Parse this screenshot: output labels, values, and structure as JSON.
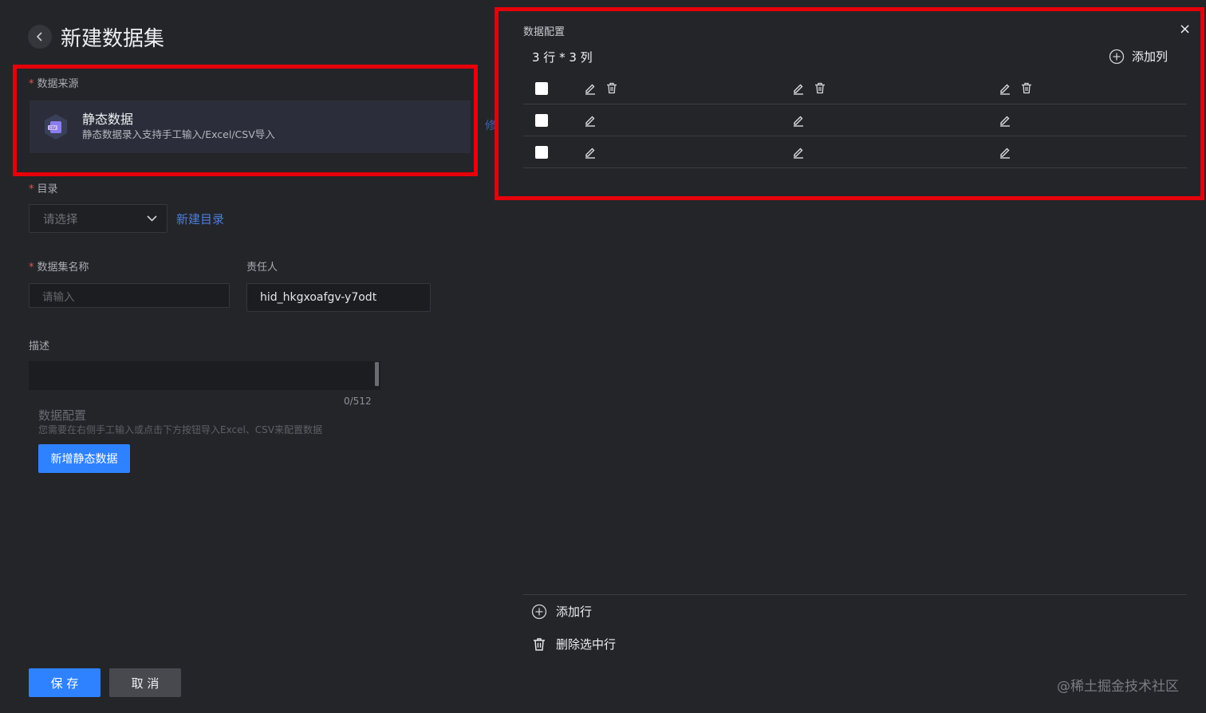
{
  "page": {
    "title": "新建数据集"
  },
  "data_source": {
    "label": "数据来源",
    "card_title": "静态数据",
    "card_desc": "静态数据录入支持手工输入/Excel/CSV导入",
    "edit_link": "修"
  },
  "catalog": {
    "label": "目录",
    "placeholder": "请选择",
    "new_link": "新建目录"
  },
  "dataset_name": {
    "label": "数据集名称",
    "placeholder": "请输入"
  },
  "owner": {
    "label": "责任人",
    "value": "hid_hkgxoafgv-y7odt"
  },
  "description": {
    "label": "描述",
    "counter": "0/512"
  },
  "data_config_section": {
    "title": "数据配置",
    "hint": "您需要在右侧手工输入或点击下方按钮导入Excel、CSV来配置数据",
    "add_button": "新增静态数据"
  },
  "footer": {
    "save": "保 存",
    "cancel": "取 消"
  },
  "config_panel": {
    "title": "数据配置",
    "close": "×",
    "dimensions": "3 行 * 3 列",
    "add_column": "添加列",
    "add_row": "添加行",
    "delete_selected": "删除选中行",
    "row_count": 3,
    "col_count": 3
  },
  "watermark": "@稀土掘金技术社区",
  "colors": {
    "background": "#242529",
    "highlight": "#e6000a",
    "primary": "#2f82ff",
    "link": "#4a7fd8"
  },
  "icons": [
    "chevron-left-icon",
    "chevron-down-icon",
    "data-file-icon",
    "plus-circle-icon",
    "edit-icon",
    "trash-icon",
    "close-icon"
  ]
}
